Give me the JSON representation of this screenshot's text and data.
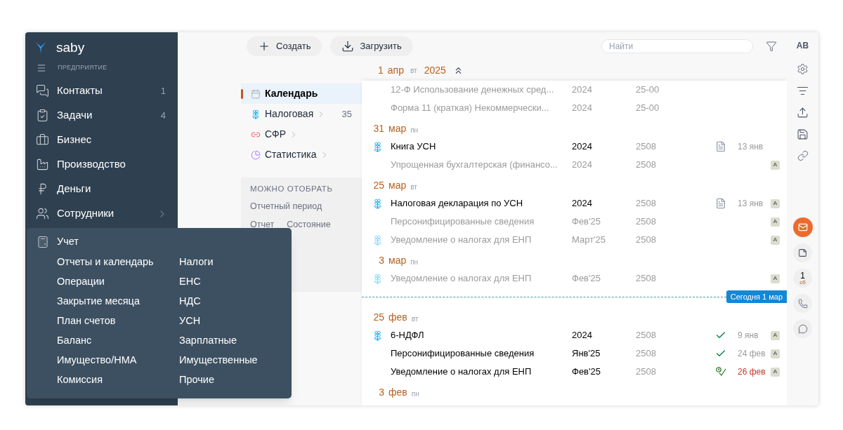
{
  "sidebar": {
    "logo": "saby",
    "section": "ПРЕДПРИЯТИЕ",
    "items": [
      {
        "label": "Контакты",
        "count": "1",
        "chevron": false
      },
      {
        "label": "Задачи",
        "count": "4",
        "chevron": false
      },
      {
        "label": "Бизнес",
        "chevron": false
      },
      {
        "label": "Производство",
        "chevron": false
      },
      {
        "label": "Деньги",
        "chevron": false
      },
      {
        "label": "Сотрудники",
        "chevron": true
      }
    ]
  },
  "menu": {
    "title": "Учет",
    "columns": [
      [
        "Отчеты и календарь",
        "Операции",
        "Закрытие месяца",
        "План счетов",
        "Баланс",
        "Имущество/НМА",
        "Комиссия"
      ],
      [
        "Налоги",
        "ЕНС",
        "НДС",
        "УСН",
        "Зарплатные",
        "Имущественные",
        "Прочие"
      ]
    ]
  },
  "toolbar": {
    "buttons": [
      "Создать",
      "Загрузить"
    ],
    "search": {
      "placeholder": "Найти"
    }
  },
  "nav": {
    "items": [
      {
        "label": "Календарь",
        "selected": true,
        "chevron": false
      },
      {
        "label": "Налоговая",
        "selected": false,
        "chevron": true,
        "count": "35"
      },
      {
        "label": "СФР",
        "selected": false,
        "chevron": true
      },
      {
        "label": "Статистика",
        "selected": false,
        "chevron": true
      }
    ],
    "filters": {
      "title": "МОЖНО ОТОБРАТЬ",
      "items": [
        "Отчетный период",
        "Отчет",
        "Состояние"
      ]
    }
  },
  "calendar": {
    "header": {
      "day": "1",
      "month": "апр",
      "weekday": "вт",
      "year": "2025"
    },
    "entries": [
      {
        "kind": "row",
        "icon": false,
        "muted": true,
        "title": "12-Ф Использование денежных сред...",
        "period": "2024",
        "code": "25-00"
      },
      {
        "kind": "row",
        "icon": false,
        "muted": true,
        "title": "Форма 11 (краткая) Некоммерчески...",
        "period": "2024",
        "code": "25-00"
      },
      {
        "kind": "date",
        "day": "31",
        "month": "мар",
        "weekday": "пн"
      },
      {
        "kind": "row",
        "icon": true,
        "muted": false,
        "title": "Книга УСН",
        "period": "2024",
        "code": "2508",
        "document": true,
        "due": "13 янв",
        "overdue": false
      },
      {
        "kind": "row",
        "icon": false,
        "muted": true,
        "title": "Упрощенная бухгалтерская (финансо...",
        "period": "2024",
        "code": "2508",
        "badge": "А"
      },
      {
        "kind": "date",
        "day": "25",
        "month": "мар",
        "weekday": "вт"
      },
      {
        "kind": "row",
        "icon": true,
        "muted": false,
        "title": "Налоговая декларация по УСН",
        "period": "2024",
        "code": "2508",
        "document": true,
        "due": "13 янв",
        "overdue": false,
        "badge": "А"
      },
      {
        "kind": "row",
        "icon": false,
        "muted": true,
        "title": "Персонифицированные сведения",
        "period": "Фев'25",
        "code": "2508",
        "badge": "А"
      },
      {
        "kind": "row",
        "icon": true,
        "muted": true,
        "title": "Уведомление о налогах для ЕНП",
        "period": "Март'25",
        "code": "2508",
        "badge": "А"
      },
      {
        "kind": "date",
        "day": "3",
        "month": "мар",
        "weekday": "пн"
      },
      {
        "kind": "row",
        "icon": true,
        "muted": true,
        "title": "Уведомление о налогах для ЕНП",
        "period": "Фев'25",
        "code": "2508",
        "badge": "А"
      },
      {
        "kind": "today",
        "label": "Сегодня 1 мар"
      },
      {
        "kind": "date",
        "day": "25",
        "month": "фев",
        "weekday": "вт"
      },
      {
        "kind": "row",
        "icon": true,
        "muted": false,
        "title": "6-НДФЛ",
        "period": "2024",
        "code": "2508",
        "accepted": true,
        "waiting": false,
        "due": "9 янв",
        "overdue": false,
        "badge": "А"
      },
      {
        "kind": "row",
        "icon": false,
        "muted": false,
        "title": "Персонифицированные сведения",
        "period": "Янв'25",
        "code": "2508",
        "accepted": true,
        "waiting": false,
        "due": "24 фев",
        "overdue": false,
        "badge": "А"
      },
      {
        "kind": "row",
        "icon": false,
        "muted": false,
        "title": "Уведомление о налогах для ЕНП",
        "period": "Фев'25",
        "code": "2508",
        "accepted": true,
        "waiting": true,
        "due": "26 фев",
        "overdue": true,
        "badge": "А"
      },
      {
        "kind": "date",
        "day": "3",
        "month": "фев",
        "weekday": "пн"
      }
    ]
  },
  "rail": {
    "lang": "AB",
    "calendar_day": "1",
    "calendar_weekday": "сб"
  }
}
